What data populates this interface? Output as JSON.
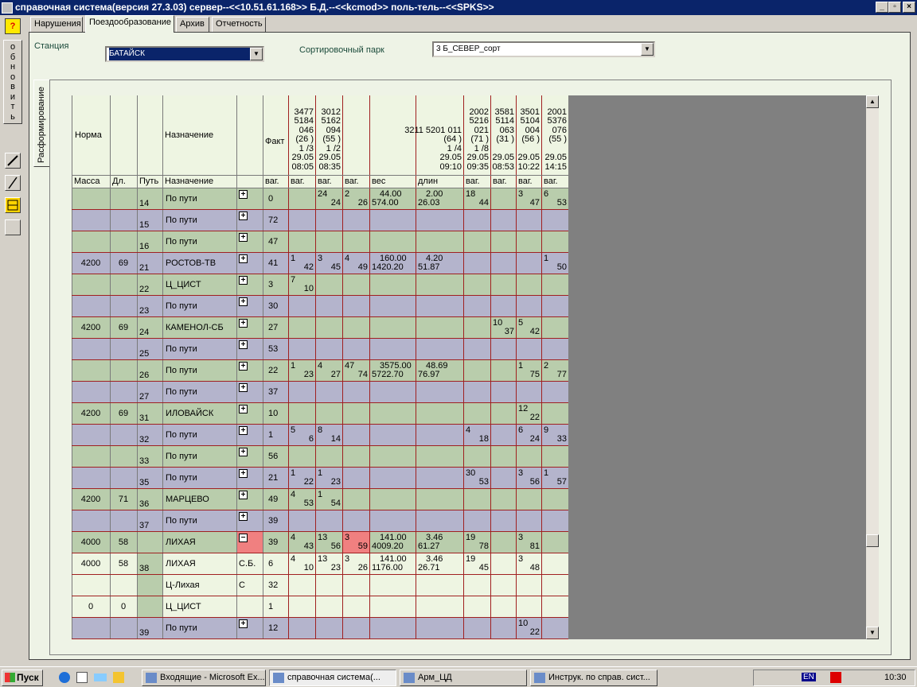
{
  "window": {
    "title": "справочная система(версия 27.3.03) сервер--<<10.51.61.168>> Б.Д.--<<kcmod>> поль-тель--<<SPKS>>"
  },
  "toolbar": {
    "help": "?",
    "refresh_letters": [
      "о",
      "б",
      "н",
      "о",
      "в",
      "и",
      "т",
      "ь"
    ]
  },
  "tabs": [
    "Нарушения",
    "Поездообразование",
    "Архив",
    "Отчетность"
  ],
  "active_tab": 1,
  "station": {
    "label": "Станция",
    "value": "БАТАЙСК"
  },
  "park": {
    "label": "Сортировочный парк",
    "value": "3 Б_СЕВЕР_сорт"
  },
  "vertical_tab": "Расформирование",
  "grid": {
    "header": {
      "norma": "Норма",
      "naznachenie": "Назначение",
      "fakt": "Факт",
      "trains": [
        [
          "3477",
          "5184",
          "046",
          "(26 )",
          "1 /3",
          "29.05",
          "08:05"
        ],
        [
          "3012",
          "5162",
          "094",
          "(55 )",
          "1 /2",
          "29.05",
          "08:35"
        ],
        [
          "3211 5201 011",
          "(64 )",
          "1 /4",
          "29.05",
          "09:10"
        ],
        [
          "2002",
          "5216",
          "021",
          "(71 )",
          "1 /8",
          "29.05",
          "09:35"
        ],
        [
          "3581",
          "5114",
          "063",
          "(31 )",
          "",
          "29.05",
          "08:53"
        ],
        [
          "3501",
          "5104",
          "004",
          "(56 )",
          "",
          "29.05",
          "10:22"
        ],
        [
          "2001",
          "5376",
          "076",
          "(55 )",
          "",
          "29.05",
          "14:15"
        ]
      ]
    },
    "sub": [
      "Масса",
      "Дл.",
      "Путь",
      "Назначение",
      "",
      "ваг.",
      "ваг.",
      "ваг.",
      "ваг.",
      "вес",
      "длин",
      "ваг.",
      "ваг.",
      "ваг.",
      "ваг."
    ],
    "rows": [
      {
        "mass": "",
        "len": "",
        "path": "14",
        "dest": "По пути",
        "s": "+",
        "fakt": "0",
        "c": [
          "",
          "24|24",
          "2|26",
          "44.00|574.00",
          "2.00|26.03",
          "18|44",
          "",
          "3|47",
          "6|53"
        ],
        "color": "g"
      },
      {
        "mass": "",
        "len": "",
        "path": "15",
        "dest": "По пути",
        "s": "+",
        "fakt": "72",
        "c": [
          "",
          "",
          "",
          "",
          "",
          "",
          "",
          "",
          ""
        ],
        "color": "p"
      },
      {
        "mass": "",
        "len": "",
        "path": "16",
        "dest": "По пути",
        "s": "+",
        "fakt": "47",
        "c": [
          "",
          "",
          "",
          "",
          "",
          "",
          "",
          "",
          ""
        ],
        "color": "g"
      },
      {
        "mass": "4200",
        "len": "69",
        "path": "21",
        "dest": "РОСТОВ-ТВ",
        "s": "+",
        "fakt": "41",
        "c": [
          "1|42",
          "3|45",
          "4|49",
          "160.00|1420.20",
          "4.20|51.87",
          "",
          "",
          "",
          "1|50"
        ],
        "color": "p"
      },
      {
        "mass": "",
        "len": "",
        "path": "22",
        "dest": "Ц_ЦИСТ",
        "s": "+",
        "fakt": "3",
        "c": [
          "7|10",
          "",
          "",
          "",
          "",
          "",
          "",
          "",
          ""
        ],
        "color": "g"
      },
      {
        "mass": "",
        "len": "",
        "path": "23",
        "dest": "По пути",
        "s": "+",
        "fakt": "30",
        "c": [
          "",
          "",
          "",
          "",
          "",
          "",
          "",
          "",
          ""
        ],
        "color": "p"
      },
      {
        "mass": "4200",
        "len": "69",
        "path": "24",
        "dest": "КАМЕНОЛ-СБ",
        "s": "+",
        "fakt": "27",
        "c": [
          "",
          "",
          "",
          "",
          "",
          "",
          "10|37",
          "5|42",
          ""
        ],
        "color": "g"
      },
      {
        "mass": "",
        "len": "",
        "path": "25",
        "dest": "По пути",
        "s": "+",
        "fakt": "53",
        "c": [
          "",
          "",
          "",
          "",
          "",
          "",
          "",
          "",
          ""
        ],
        "color": "p"
      },
      {
        "mass": "",
        "len": "",
        "path": "26",
        "dest": "По пути",
        "s": "+",
        "fakt": "22",
        "c": [
          "1|23",
          "4|27",
          "47|74",
          "3575.00|5722.70",
          "48.69|76.97",
          "",
          "",
          "1|75",
          "2|77"
        ],
        "color": "g"
      },
      {
        "mass": "",
        "len": "",
        "path": "27",
        "dest": "По пути",
        "s": "+",
        "fakt": "37",
        "c": [
          "",
          "",
          "",
          "",
          "",
          "",
          "",
          "",
          ""
        ],
        "color": "p"
      },
      {
        "mass": "4200",
        "len": "69",
        "path": "31",
        "dest": "ИЛОВАЙСК",
        "s": "+",
        "fakt": "10",
        "c": [
          "",
          "",
          "",
          "",
          "",
          "",
          "",
          "12|22",
          ""
        ],
        "color": "g"
      },
      {
        "mass": "",
        "len": "",
        "path": "32",
        "dest": "По пути",
        "s": "+",
        "fakt": "1",
        "c": [
          "5|6",
          "8|14",
          "",
          "",
          "",
          "4|18",
          "",
          "6|24",
          "9|33"
        ],
        "color": "p"
      },
      {
        "mass": "",
        "len": "",
        "path": "33",
        "dest": "По пути",
        "s": "+",
        "fakt": "56",
        "c": [
          "",
          "",
          "",
          "",
          "",
          "",
          "",
          "",
          ""
        ],
        "color": "g"
      },
      {
        "mass": "",
        "len": "",
        "path": "35",
        "dest": "По пути",
        "s": "+",
        "fakt": "21",
        "c": [
          "1|22",
          "1|23",
          "",
          "",
          "",
          "30|53",
          "",
          "3|56",
          "1|57"
        ],
        "color": "p"
      },
      {
        "mass": "4200",
        "len": "71",
        "path": "36",
        "dest": "МАРЦЕВО",
        "s": "+",
        "fakt": "49",
        "c": [
          "4|53",
          "1|54",
          "",
          "",
          "",
          "",
          "",
          "",
          ""
        ],
        "color": "g"
      },
      {
        "mass": "",
        "len": "",
        "path": "37",
        "dest": "По пути",
        "s": "+",
        "fakt": "39",
        "c": [
          "",
          "",
          "",
          "",
          "",
          "",
          "",
          "",
          ""
        ],
        "color": "p"
      },
      {
        "mass": "4000",
        "len": "58",
        "path": "",
        "dest": "ЛИХАЯ",
        "s": "-",
        "fakt": "39",
        "c": [
          "4|43",
          "13|56",
          "3|59",
          "141.00|4009.20",
          "3.46|61.27",
          "19|78",
          "",
          "3|81",
          ""
        ],
        "color": "g"
      },
      {
        "mass": "4000",
        "len": "58",
        "path": "38",
        "dest": "ЛИХАЯ",
        "s": "С.Б.",
        "fakt": "6",
        "c": [
          "4|10",
          "13|23",
          "3|26",
          "141.00|1176.00",
          "3.46|26.71",
          "19|45",
          "",
          "3|48",
          ""
        ],
        "color": "l"
      },
      {
        "mass": "",
        "len": "",
        "path": "",
        "dest": "Ц-Лихая",
        "s": "С",
        "fakt": "32",
        "c": [
          "",
          "",
          "",
          "",
          "",
          "",
          "",
          "",
          ""
        ],
        "color": "l"
      },
      {
        "mass": "0",
        "len": "0",
        "path": "",
        "dest": "Ц_ЦИСТ",
        "s": "",
        "fakt": "1",
        "c": [
          "",
          "",
          "",
          "",
          "",
          "",
          "",
          "",
          ""
        ],
        "color": "l"
      },
      {
        "mass": "",
        "len": "",
        "path": "39",
        "dest": "По пути",
        "s": "+",
        "fakt": "12",
        "c": [
          "",
          "",
          "",
          "",
          "",
          "",
          "",
          "10|22",
          ""
        ],
        "color": "p"
      }
    ]
  },
  "taskbar": {
    "start": "Пуск",
    "tasks": [
      "Входящие - Microsoft Ex...",
      "справочная система(...",
      "Арм_ЦД",
      "Инструк. по справ. сист..."
    ],
    "lang": "EN",
    "clock": "10:30"
  }
}
